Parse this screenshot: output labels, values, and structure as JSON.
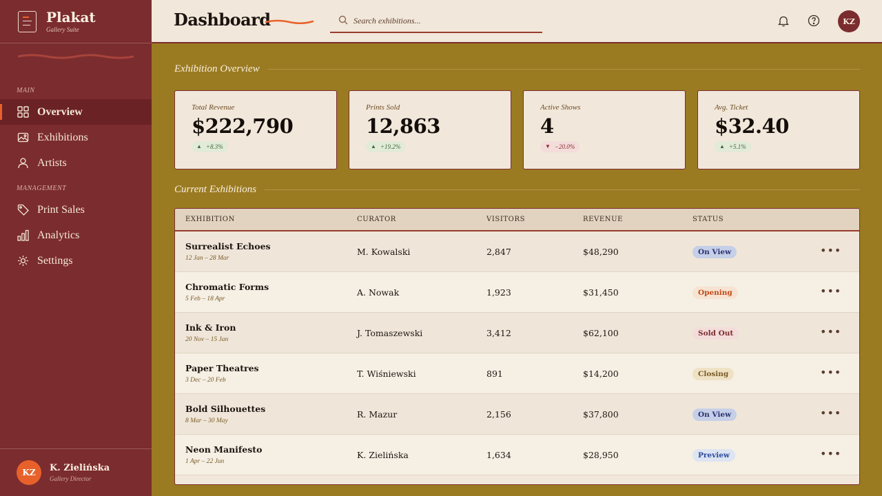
{
  "brand": {
    "name": "Plakat",
    "subtitle": "Gallery Suite"
  },
  "sidebar": {
    "sections": [
      "MAIN",
      "MANAGEMENT"
    ],
    "items": [
      {
        "label": "Overview",
        "icon": "grid-icon",
        "active": true
      },
      {
        "label": "Exhibitions",
        "icon": "image-icon",
        "active": false
      },
      {
        "label": "Artists",
        "icon": "user-icon",
        "active": false
      },
      {
        "label": "Print Sales",
        "icon": "tag-icon",
        "active": false
      },
      {
        "label": "Analytics",
        "icon": "bar-chart-icon",
        "active": false
      },
      {
        "label": "Settings",
        "icon": "gear-icon",
        "active": false
      }
    ],
    "user": {
      "initials": "KZ",
      "name": "K. Zielińska",
      "role": "Gallery Director"
    }
  },
  "header": {
    "title": "Dashboard",
    "search_placeholder": "Search exhibitions...",
    "avatar_initials": "KZ"
  },
  "overview": {
    "title": "Exhibition Overview",
    "cards": [
      {
        "label": "Total Revenue",
        "value": "$222,790",
        "delta": "+8.3%",
        "direction": "up"
      },
      {
        "label": "Prints Sold",
        "value": "12,863",
        "delta": "+19.2%",
        "direction": "up"
      },
      {
        "label": "Active Shows",
        "value": "4",
        "delta": "−20.0%",
        "direction": "down"
      },
      {
        "label": "Avg. Ticket",
        "value": "$32.40",
        "delta": "+5.1%",
        "direction": "up"
      }
    ]
  },
  "exhibitions": {
    "title": "Current Exhibitions",
    "columns": [
      "EXHIBITION",
      "CURATOR",
      "VISITORS",
      "REVENUE",
      "STATUS"
    ],
    "rows": [
      {
        "name": "Surrealist Echoes",
        "dates": "12 Jan – 28 Mar",
        "curator": "M. Kowalski",
        "visitors": "2,847",
        "revenue": "$48,290",
        "status": "On View"
      },
      {
        "name": "Chromatic Forms",
        "dates": "5 Feb – 18 Apr",
        "curator": "A. Nowak",
        "visitors": "1,923",
        "revenue": "$31,450",
        "status": "Opening"
      },
      {
        "name": "Ink & Iron",
        "dates": "20 Nov – 15 Jan",
        "curator": "J. Tomaszewski",
        "visitors": "3,412",
        "revenue": "$62,100",
        "status": "Sold Out"
      },
      {
        "name": "Paper Theatres",
        "dates": "3 Dec – 20 Feb",
        "curator": "T. Wiśniewski",
        "visitors": "891",
        "revenue": "$14,200",
        "status": "Closing"
      },
      {
        "name": "Bold Silhouettes",
        "dates": "8 Mar – 30 May",
        "curator": "R. Mazur",
        "visitors": "2,156",
        "revenue": "$37,800",
        "status": "On View"
      },
      {
        "name": "Neon Manifesto",
        "dates": "1 Apr – 22 Jun",
        "curator": "K. Zielińska",
        "visitors": "1,634",
        "revenue": "$28,950",
        "status": "Preview"
      }
    ],
    "more_label": "•••"
  },
  "colors": {
    "sidebar": "#7b2c2e",
    "accent": "#e8612a",
    "background": "#9a7b22",
    "surface": "#f1e7da",
    "status_on_view": "#c6cfe8",
    "status_opening": "#f7e3d2",
    "status_sold_out": "#f3dcda",
    "status_closing": "#efe2c4",
    "status_preview": "#dde4f2"
  }
}
